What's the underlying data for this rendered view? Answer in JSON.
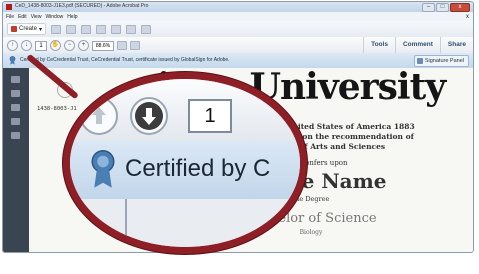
{
  "window": {
    "title": "CeD_1438-8003-J1E3.pdf (SECURED) - Adobe Acrobat Pro",
    "close_glyph": "x"
  },
  "menu": [
    "File",
    "Edit",
    "View",
    "Window",
    "Help"
  ],
  "menu_close": "x",
  "toolbar": {
    "create_label": "Create"
  },
  "nav": {
    "page_number": "1",
    "zoom": "88.6%"
  },
  "right_links": [
    "Tools",
    "Comment",
    "Share"
  ],
  "certbar": {
    "text": "Certified by CeCredential Trust, CeCredential Trust, certificate issued by GlobalSign for Adobe.",
    "signature_panel": "Signature Panel"
  },
  "document": {
    "title": "rican University",
    "line1": "Congress of the United States of America 1883",
    "line2": "ard of Trustees and on the recommendation of",
    "line3": "The College of Arts and Sciences",
    "confers": "hereby confers upon",
    "name": "hn Sample Name",
    "degree_label": "the Degree",
    "degree": "Bachelor of Science",
    "field": "Biology",
    "serial": "1438-8003-J1"
  },
  "magnifier": {
    "page_number": "1",
    "cert_text": "Certified by C"
  }
}
